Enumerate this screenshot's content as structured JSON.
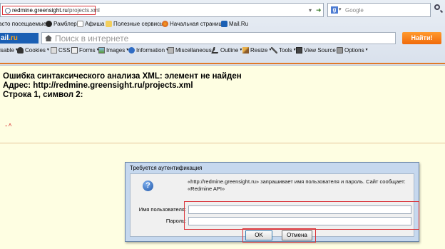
{
  "browser": {
    "url_host": "redmine.greensight.ru",
    "url_path": "/projects.xml",
    "search_placeholder": "Google",
    "search_engine_icon": "g-icon"
  },
  "bookmarks": [
    {
      "label": "асто посещаемые",
      "icon": "gear-icon"
    },
    {
      "label": "Рамблер",
      "icon": "rambler-icon"
    },
    {
      "label": "Афиша",
      "icon": "page-icon"
    },
    {
      "label": "Полезные сервисы",
      "icon": "folder-icon"
    },
    {
      "label": "Начальная страница",
      "icon": "firefox-icon"
    },
    {
      "label": "Mail.Ru",
      "icon": "mail-icon"
    }
  ],
  "mail_toolbar": {
    "logo_left": "ail",
    "logo_right": ".ru",
    "search_placeholder": "Поиск в интернете",
    "find_button": "Найти!"
  },
  "dev_toolbar": [
    {
      "label": "isable",
      "icon": ""
    },
    {
      "label": "Cookies",
      "icon": "cookie-icon"
    },
    {
      "label": "CSS",
      "icon": "css-icon"
    },
    {
      "label": "Forms",
      "icon": "forms-icon"
    },
    {
      "label": "Images",
      "icon": "images-icon"
    },
    {
      "label": "Information",
      "icon": "info-icon"
    },
    {
      "label": "Miscellaneous",
      "icon": "misc-icon"
    },
    {
      "label": "Outline",
      "icon": "outline-icon"
    },
    {
      "label": "Resize",
      "icon": "resize-icon"
    },
    {
      "label": "Tools",
      "icon": "tools-icon"
    },
    {
      "label": "View Source",
      "icon": "source-icon"
    },
    {
      "label": "Options",
      "icon": "options-icon"
    }
  ],
  "page": {
    "error_line1": "Ошибка синтаксического анализа XML: элемент не найден",
    "error_line2": "Адрес: http://redmine.greensight.ru/projects.xml",
    "error_line3": "Строка 1, символ 2:",
    "caret_line": "-^"
  },
  "dialog": {
    "title": "Требуется аутентификация",
    "message": "«http://redmine.greensight.ru» запрашивает имя пользователя и пароль. Сайт сообщает: «Redmine API»",
    "username_label": "Имя пользователя:",
    "password_label": "Пароль:",
    "username_value": "",
    "password_value": "",
    "ok_label": "OK",
    "cancel_label": "Отмена"
  },
  "colors": {
    "highlight": "#d9343a",
    "page_background": "#fefee2",
    "find_button": "#f06a0a"
  }
}
